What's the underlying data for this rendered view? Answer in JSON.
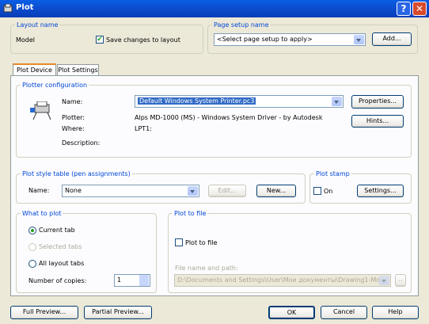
{
  "window": {
    "title": "Plot"
  },
  "layout_name": {
    "legend": "Layout name",
    "value": "Model",
    "save_changes_label": "Save changes to layout",
    "save_changes_checked": true
  },
  "page_setup": {
    "legend": "Page setup name",
    "value": "<Select page setup to apply>",
    "add_label": "Add..."
  },
  "tabs": [
    {
      "label": "Plot Device",
      "active": true
    },
    {
      "label": "Plot Settings",
      "active": false
    }
  ],
  "plotter": {
    "legend": "Plotter configuration",
    "name_label": "Name:",
    "name_value": "Default Windows System Printer.pc3",
    "properties_label": "Properties...",
    "hints_label": "Hints...",
    "plotter_label": "Plotter:",
    "plotter_value": "Alps MD-1000 (MS) - Windows System Driver - by Autodesk",
    "where_label": "Where:",
    "where_value": "LPT1:",
    "description_label": "Description:"
  },
  "plot_style": {
    "legend": "Plot style table (pen assignments)",
    "name_label": "Name:",
    "name_value": "None",
    "edit_label": "Edit...",
    "new_label": "New..."
  },
  "plot_stamp": {
    "legend": "Plot stamp",
    "on_label": "On",
    "settings_label": "Settings..."
  },
  "what_to_plot": {
    "legend": "What to plot",
    "current_tab": "Current tab",
    "selected_tabs": "Selected tabs",
    "all_layout_tabs": "All layout tabs",
    "copies_label": "Number of copies:",
    "copies_value": "1"
  },
  "plot_to_file": {
    "legend": "Plot to file",
    "checkbox_label": "Plot to file",
    "path_label": "File name and path:",
    "path_value": "D:\\Documents and Settings\\User\\Мои документы\\Drawing1-Mo"
  },
  "footer": {
    "full_preview": "Full Preview...",
    "partial_preview": "Partial Preview...",
    "ok": "OK",
    "cancel": "Cancel",
    "help": "Help"
  }
}
